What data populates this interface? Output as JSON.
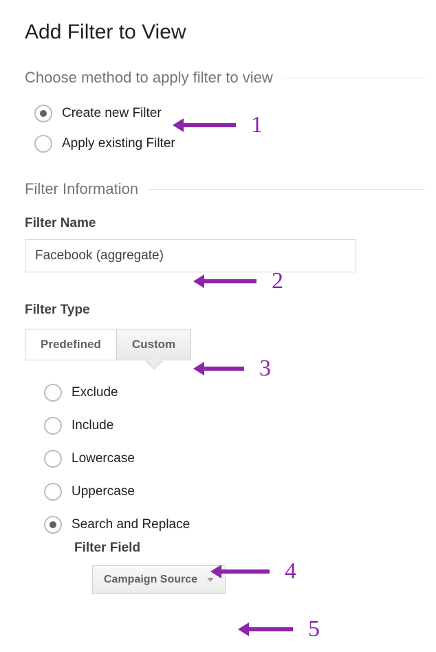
{
  "title": "Add Filter to View",
  "section_method": "Choose method to apply filter to view",
  "method_options": {
    "create": "Create new Filter",
    "apply": "Apply existing Filter"
  },
  "section_info": "Filter Information",
  "filter_name_label": "Filter Name",
  "filter_name_value": "Facebook (aggregate)",
  "filter_type_label": "Filter Type",
  "tabs": {
    "predefined": "Predefined",
    "custom": "Custom"
  },
  "custom_options": {
    "exclude": "Exclude",
    "include": "Include",
    "lowercase": "Lowercase",
    "uppercase": "Uppercase",
    "search_replace": "Search and Replace"
  },
  "filter_field_label": "Filter Field",
  "filter_field_value": "Campaign Source",
  "annotations": {
    "a1": "1",
    "a2": "2",
    "a3": "3",
    "a4": "4",
    "a5": "5"
  },
  "colors": {
    "annotation": "#8e24aa"
  }
}
